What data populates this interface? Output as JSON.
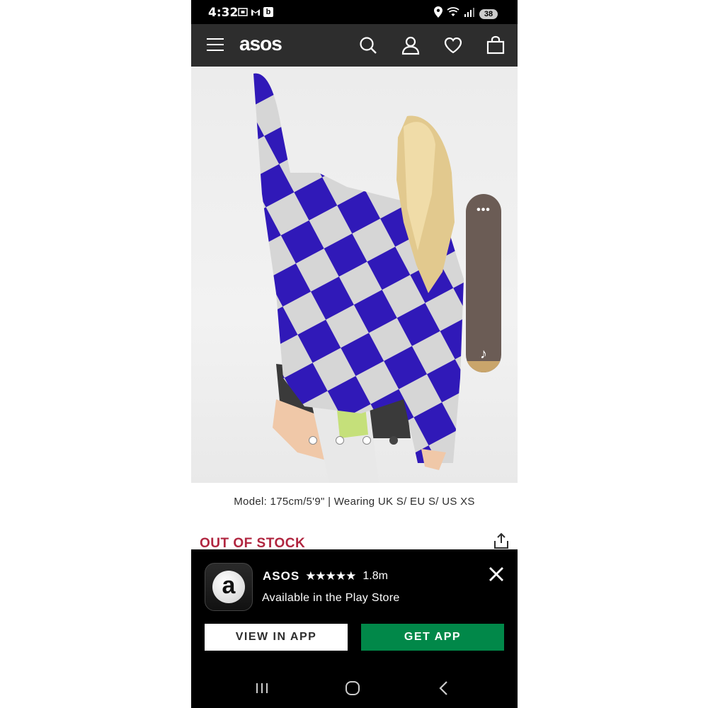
{
  "status_bar": {
    "time": "4:32",
    "left_icons": [
      "screenshot-icon",
      "gmail-icon",
      "b-app-icon"
    ],
    "b_icon_label": "b",
    "battery": "38"
  },
  "header": {
    "logo": "asos",
    "icons": [
      "search-icon",
      "account-icon",
      "heart-icon",
      "bag-icon"
    ]
  },
  "product": {
    "carousel": {
      "count": 4,
      "active_index": 3
    },
    "floating_tab": {
      "dots": "•••",
      "icon": "music-note-icon"
    },
    "model_info": "Model: 175cm/5'9\" | Wearing UK S/ EU S/ US XS",
    "stock_status": "OUT OF STOCK"
  },
  "banner": {
    "app_name": "ASOS",
    "stars": "★★★★★",
    "rating_count": "1.8m",
    "subtitle": "Available in the Play Store",
    "logo_letter": "a",
    "view_button": "VIEW IN APP",
    "get_button": "GET APP",
    "colors": {
      "get_button": "#018849",
      "stock": "#b0253f",
      "header": "#2d2d2d"
    }
  },
  "nav_bar": {
    "items": [
      "recents-icon",
      "home-icon",
      "back-icon"
    ]
  }
}
